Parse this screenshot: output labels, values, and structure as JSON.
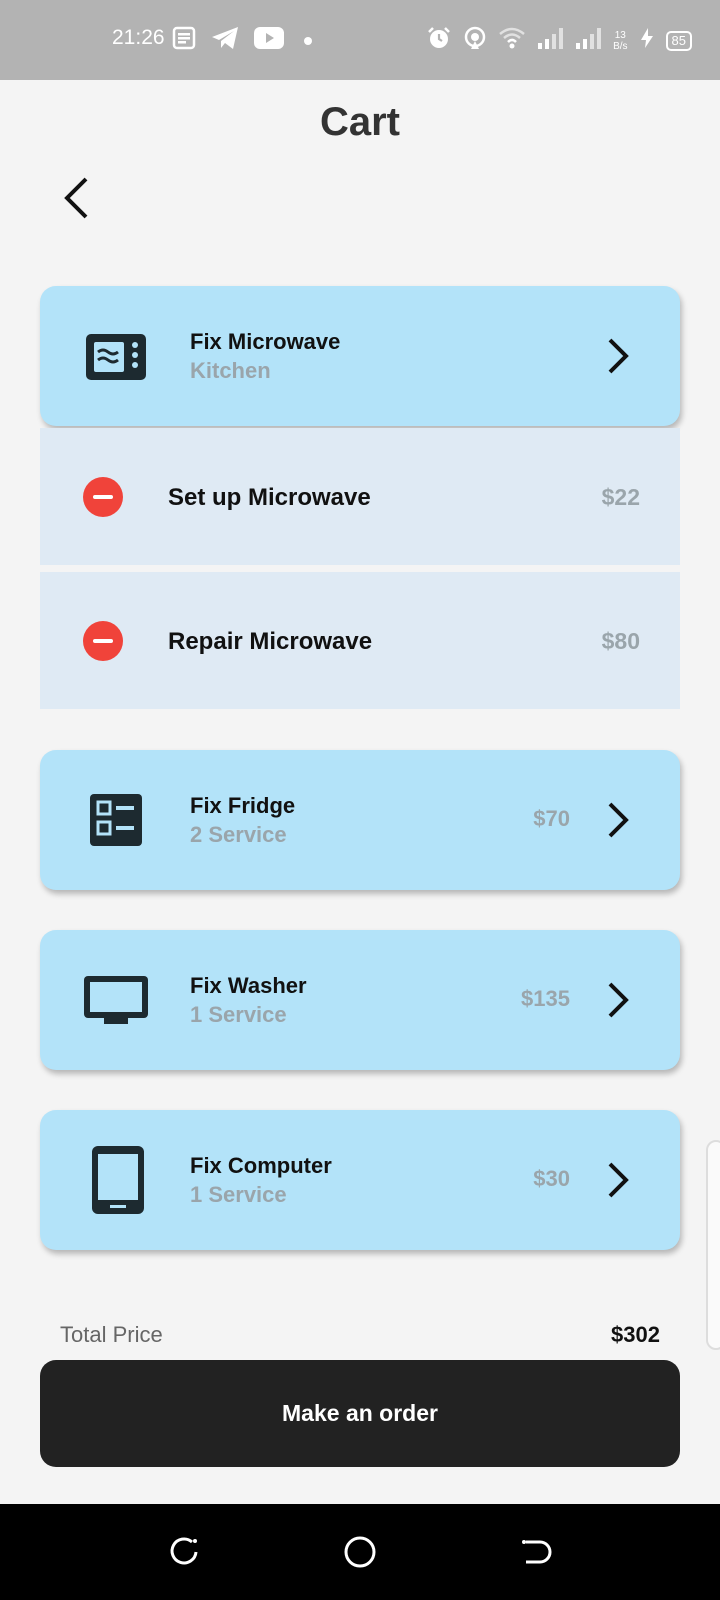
{
  "status_bar": {
    "time": "21:26",
    "net_speed_value": "13",
    "net_speed_unit": "B/s",
    "battery": "85"
  },
  "header": {
    "title": "Cart"
  },
  "cart": {
    "groups": [
      {
        "title": "Fix Microwave",
        "subtitle": "Kitchen",
        "price": "",
        "icon": "microwave-icon",
        "expanded": true,
        "items": [
          {
            "name": "Set up Microwave",
            "price": "$22"
          },
          {
            "name": "Repair Microwave",
            "price": "$80"
          }
        ]
      },
      {
        "title": "Fix Fridge",
        "subtitle": "2 Service",
        "price": "$70",
        "icon": "fridge-icon"
      },
      {
        "title": "Fix Washer",
        "subtitle": "1 Service",
        "price": "$135",
        "icon": "monitor-icon"
      },
      {
        "title": "Fix Computer",
        "subtitle": "1 Service",
        "price": "$30",
        "icon": "tablet-icon"
      }
    ]
  },
  "summary": {
    "total_label": "Total Price",
    "total_value": "$302",
    "order_button": "Make an order"
  },
  "colors": {
    "card_bg": "#b3e3f9",
    "sub_item_bg": "#dfeaf4",
    "remove_red": "#f0433a",
    "button_dark": "#222222",
    "muted_text": "#9aa5ab"
  }
}
